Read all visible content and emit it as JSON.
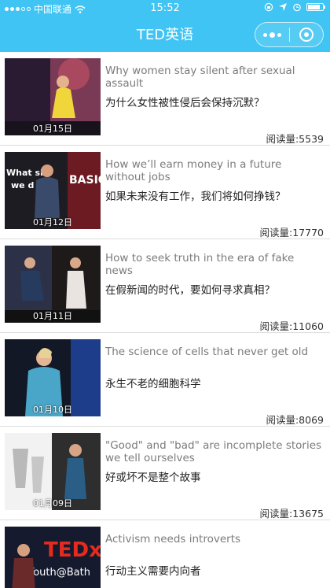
{
  "status_bar": {
    "carrier": "中国联通",
    "time": "15:52"
  },
  "header": {
    "title": "TED英语",
    "background_color": "#3fc4f3"
  },
  "articles": [
    {
      "date": "01月15日",
      "title_en": "Why women stay silent after sexual assault",
      "title_cn": "为什么女性被性侵后会保持沉默？",
      "reads": "阅读量:5539"
    },
    {
      "date": "01月12日",
      "title_en": "How we’ll earn money in a future without jobs",
      "title_cn": "如果未来没有工作，我们将如何挣钱？",
      "reads": "阅读量:17770",
      "thumb_text_1": "What sho",
      "thumb_text_2": "we d",
      "thumb_text_3": "BASIC"
    },
    {
      "date": "01月11日",
      "title_en": "How to seek truth in the era of fake news",
      "title_cn": "在假新闻的时代，要如何寻求真相？",
      "reads": "阅读量:11060"
    },
    {
      "date": "01月10日",
      "title_en": "The science of cells that never get old",
      "title_cn": "永生不老的细胞科学",
      "reads": "阅读量:8069"
    },
    {
      "date": "01月09日",
      "title_en": "\"Good\" and \"bad\" are incomplete stories we tell ourselves",
      "title_cn": "好或坏不是整个故事",
      "reads": "阅读量:13675"
    },
    {
      "date": "",
      "title_en": "Activism needs introverts",
      "title_cn": "行动主义需要内向者",
      "reads": "",
      "thumb_text_1": "TEDx",
      "thumb_text_2": "Youth@Bath"
    }
  ]
}
